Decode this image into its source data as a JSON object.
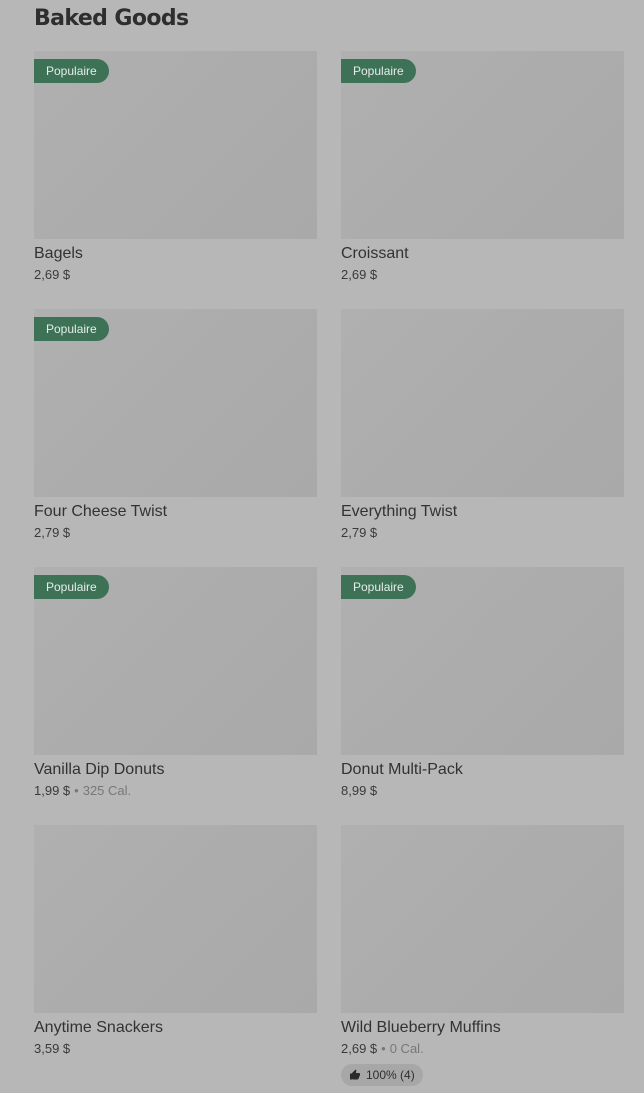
{
  "section": {
    "title": "Baked Goods"
  },
  "items": [
    {
      "name": "Bagels",
      "price": "2,69 $",
      "badge": "Populaire",
      "calories": "",
      "rating": ""
    },
    {
      "name": "Croissant",
      "price": "2,69 $",
      "badge": "Populaire",
      "calories": "",
      "rating": ""
    },
    {
      "name": "Four Cheese Twist",
      "price": "2,79 $",
      "badge": "Populaire",
      "calories": "",
      "rating": ""
    },
    {
      "name": "Everything Twist",
      "price": "2,79 $",
      "badge": "",
      "calories": "",
      "rating": ""
    },
    {
      "name": "Vanilla Dip Donuts",
      "price": "1,99 $",
      "badge": "Populaire",
      "calories": "325 Cal.",
      "rating": ""
    },
    {
      "name": "Donut Multi-Pack",
      "price": "8,99 $",
      "badge": "Populaire",
      "calories": "",
      "rating": ""
    },
    {
      "name": "Anytime Snackers",
      "price": "3,59 $",
      "badge": "",
      "calories": "",
      "rating": ""
    },
    {
      "name": "Wild Blueberry Muffins",
      "price": "2,69 $",
      "badge": "",
      "calories": "0 Cal.",
      "rating": "100% (4)"
    }
  ],
  "separator": "•",
  "icons": {
    "rating": "thumbs-up-icon"
  },
  "colors": {
    "badge_bg": "#3d7257",
    "page_bg": "#b7b7b7"
  }
}
